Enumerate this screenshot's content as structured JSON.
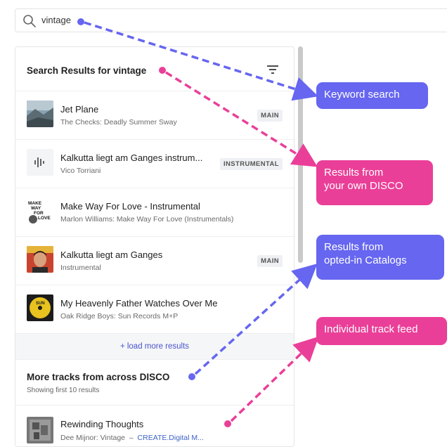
{
  "search": {
    "value": "vintage"
  },
  "panel": {
    "title": "Search Results for vintage",
    "tracks": [
      {
        "title": "Jet Plane",
        "subtitle": "The Checks: Deadly Summer Sway",
        "badge": "MAIN",
        "thumb": "photo-coast"
      },
      {
        "title": "Kalkutta liegt am Ganges instrum...",
        "subtitle": "Vico Torriani",
        "badge": "INSTRUMENTAL",
        "thumb": "waveform-icon"
      },
      {
        "title": "Make Way For Love - Instrumental",
        "subtitle": "Marlon Williams: Make Way For Love (Instrumentals)",
        "badge": "",
        "thumb": "album-cover-text"
      },
      {
        "title": "Kalkutta liegt am Ganges",
        "subtitle": "Instrumental",
        "badge": "MAIN",
        "thumb": "portrait"
      },
      {
        "title": "My Heavenly Father Watches Over Me",
        "subtitle": "Oak Ridge Boys: Sun Records M+P",
        "badge": "",
        "thumb": "sun-records-logo"
      }
    ],
    "load_more": "+ load more results",
    "more_title": "More tracks from across DISCO",
    "more_subtitle": "Showing first 10 results",
    "last_track": {
      "title": "Rewinding Thoughts",
      "subtitle_artist": "Dee Mijnor: Vintage",
      "subtitle_sep": "  –  ",
      "subtitle_link": "CREATE.Digital M..."
    },
    "thumb_text": {
      "make_way": "MAKE WAY FOR LOVE",
      "sun": "SUN"
    }
  },
  "callouts": {
    "keyword": "Keyword search",
    "own_line1": "Results from",
    "own_line2": "your own DISCO",
    "catalogs_line1": "Results from",
    "catalogs_line2": "opted-in Catalogs",
    "feed": "Individual track feed"
  },
  "colors": {
    "blue": "#6666f0",
    "pink": "#ea3f98",
    "link": "#4a55c9"
  }
}
